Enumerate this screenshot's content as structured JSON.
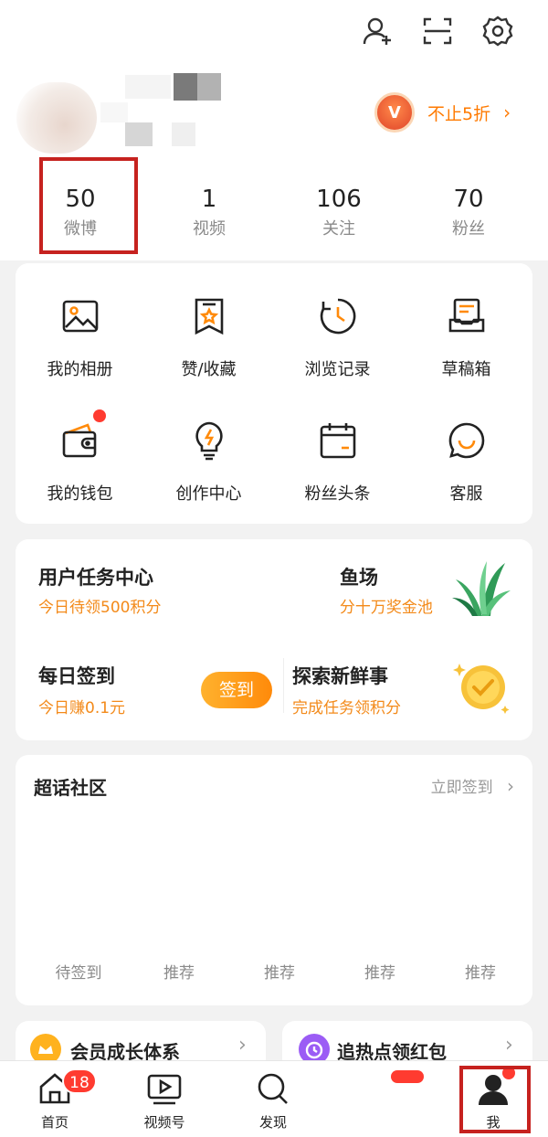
{
  "header": {
    "add_friend_icon": "add-user-icon",
    "scan_icon": "scan-icon",
    "settings_icon": "gear-icon"
  },
  "promo": {
    "badge": "V",
    "text": "不止5折",
    "arrow": "›"
  },
  "stats": [
    {
      "value": "50",
      "label": "微博"
    },
    {
      "value": "1",
      "label": "视频"
    },
    {
      "value": "106",
      "label": "关注"
    },
    {
      "value": "70",
      "label": "粉丝"
    }
  ],
  "grid": [
    {
      "label": "我的相册",
      "icon": "photo-album-icon"
    },
    {
      "label": "赞/收藏",
      "icon": "bookmark-star-icon"
    },
    {
      "label": "浏览记录",
      "icon": "history-clock-icon"
    },
    {
      "label": "草稿箱",
      "icon": "drafts-tray-icon"
    },
    {
      "label": "我的钱包",
      "icon": "wallet-icon"
    },
    {
      "label": "创作中心",
      "icon": "lightbulb-icon"
    },
    {
      "label": "粉丝头条",
      "icon": "calendar-icon"
    },
    {
      "label": "客服",
      "icon": "customer-service-icon"
    }
  ],
  "tasks": {
    "center_title": "用户任务中心",
    "center_sub": "今日待领500积分",
    "fish_title": "鱼场",
    "fish_sub": " 分十万奖金池",
    "daily_title": "每日签到",
    "daily_sub": "今日赚0.1元",
    "sign_label": "签到",
    "explore_title": "探索新鲜事",
    "explore_sub": "完成任务领积分"
  },
  "community": {
    "title": "超话社区",
    "link": "立即签到",
    "arrow": "›",
    "tabs": [
      "待签到",
      "推荐",
      "推荐",
      "推荐",
      "推荐"
    ]
  },
  "cards": {
    "member_title": "会员成长体系",
    "hot_title": "追热点领红包",
    "arrow": "›"
  },
  "bottom_nav": [
    {
      "label": "首页",
      "icon": "home-icon",
      "badge": "18"
    },
    {
      "label": "视频号",
      "icon": "video-play-icon"
    },
    {
      "label": "发现",
      "icon": "search-icon"
    },
    {
      "label": "",
      "icon": ""
    },
    {
      "label": "我",
      "icon": "profile-icon"
    }
  ],
  "colors": {
    "accent": "#ff8a0a",
    "highlight_box": "#c6221f",
    "badge_red": "#ff3b30"
  }
}
